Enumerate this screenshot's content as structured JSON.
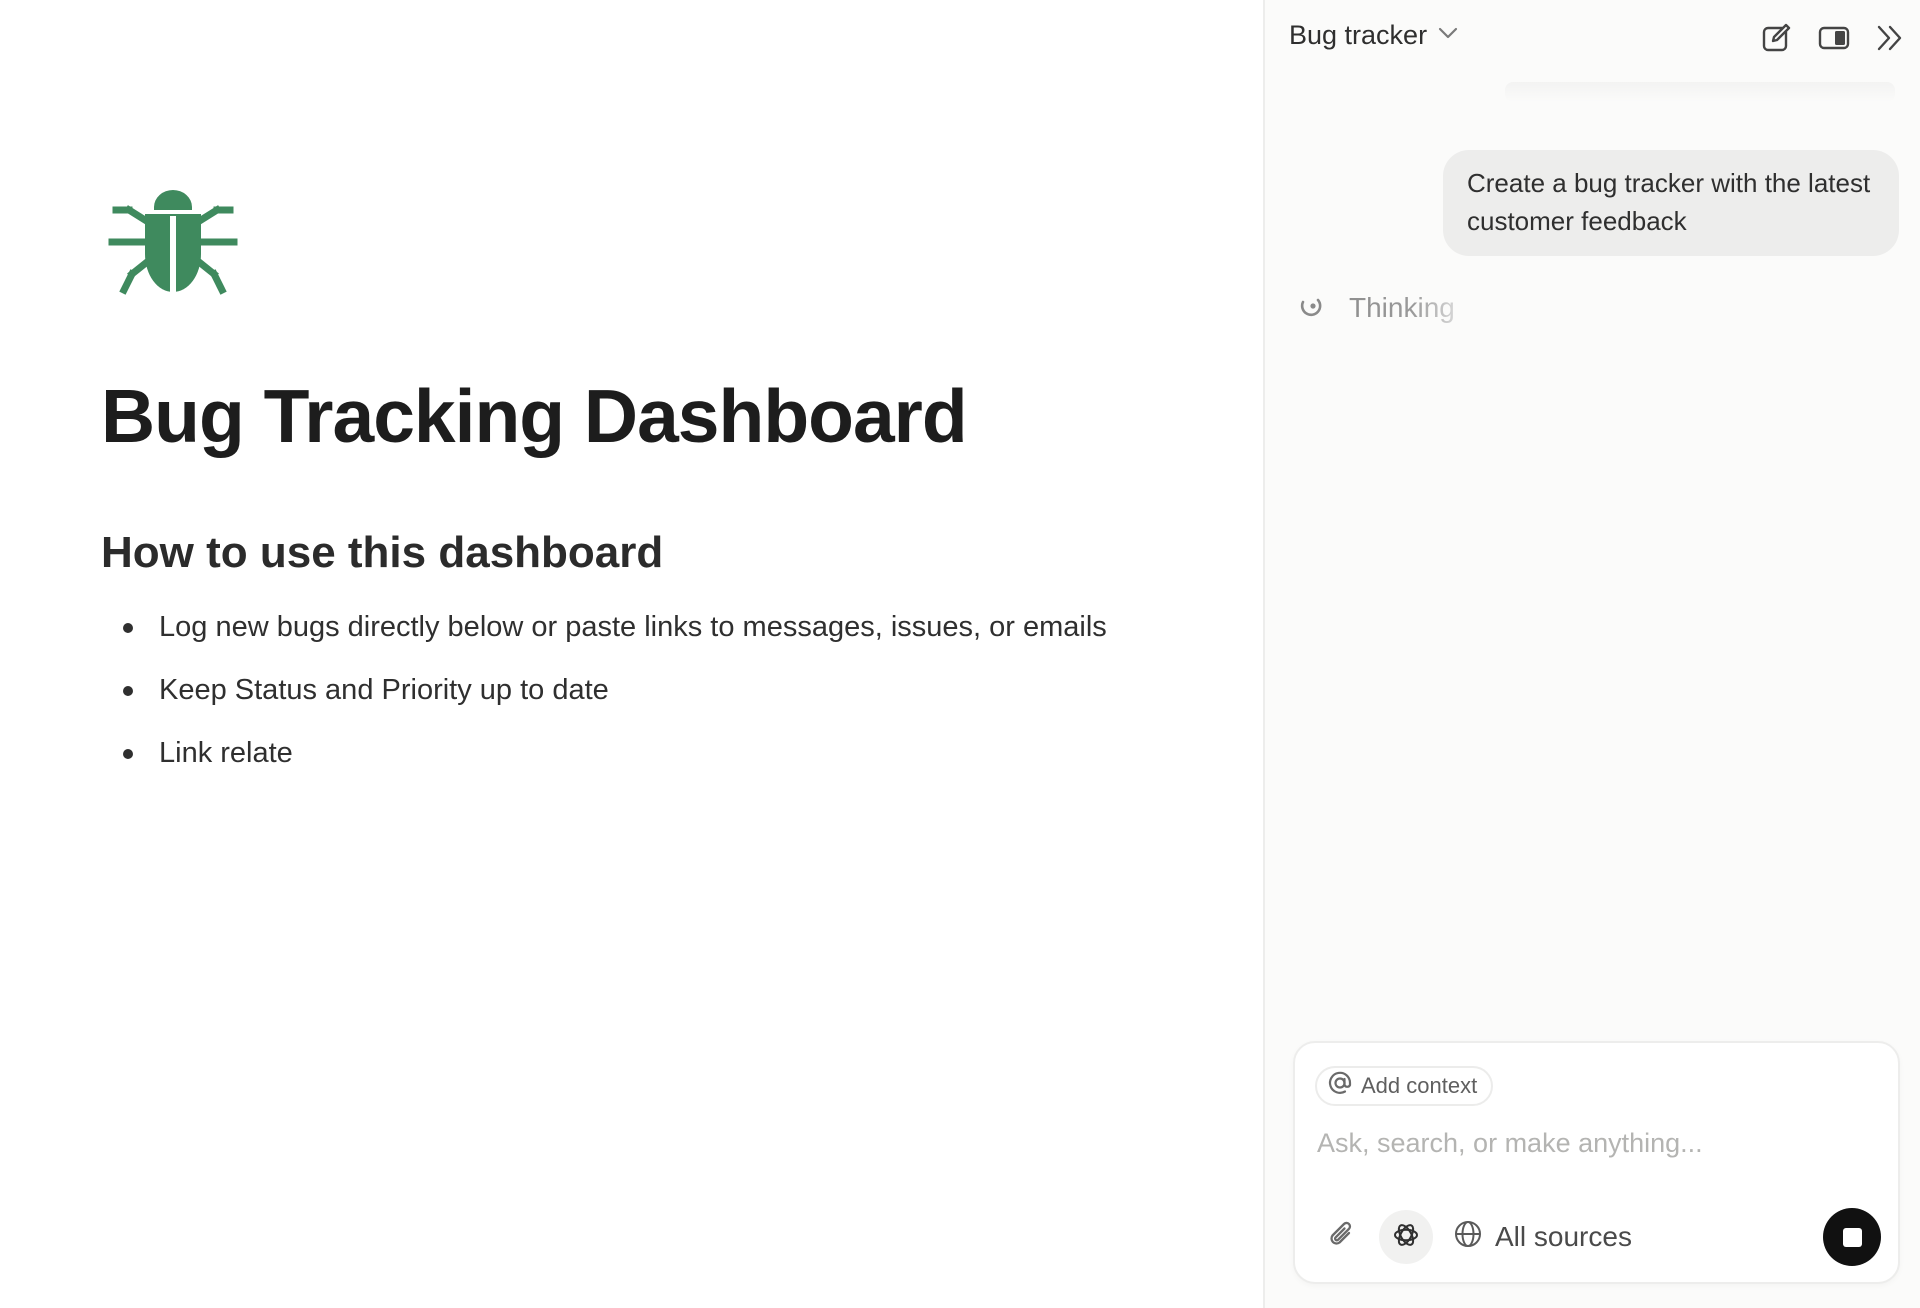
{
  "document": {
    "icon": "bug-icon",
    "icon_color": "#3f8a5e",
    "title": "Bug Tracking Dashboard",
    "section_heading": "How to use this dashboard",
    "bullets": [
      "Log new bugs directly below or paste links to messages, issues, or emails",
      "Keep Status and Priority up to date",
      "Link relate"
    ]
  },
  "ai_panel": {
    "title": "Bug tracker",
    "header_icons": [
      "chevron-down-icon",
      "new-chat-icon",
      "panel-toggle-icon",
      "collapse-panel-icon"
    ],
    "messages": [
      {
        "role": "user",
        "text": "Create a bug tracker with the latest customer feedback"
      }
    ],
    "status": {
      "icon": "spinner-icon",
      "text": "Thinking"
    },
    "composer": {
      "context_chip_label": "Add context",
      "context_chip_icon": "at-sign-icon",
      "placeholder": "Ask, search, or make anything...",
      "value": "",
      "attach_icon": "paperclip-icon",
      "model_icon": "openai-model-icon",
      "sources_label": "All sources",
      "sources_icon": "globe-icon",
      "stop_icon": "stop-icon"
    }
  },
  "colors": {
    "panel_background": "#fbfbfa",
    "bubble_background": "#ededec",
    "stop_button": "#111111",
    "bug_icon": "#3f8a5e"
  }
}
